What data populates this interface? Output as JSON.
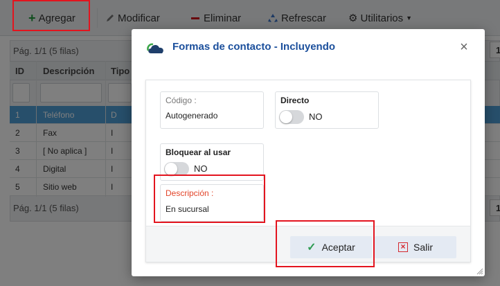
{
  "toolbar": {
    "add_label": "Agregar",
    "modify_label": "Modificar",
    "delete_label": "Eliminar",
    "refresh_label": "Refrescar",
    "utilities_label": "Utilitarios"
  },
  "grid": {
    "pager_top": "Pág. 1/1 (5 filas)",
    "pager_bottom": "Pág. 1/1 (5 filas)",
    "pager_page": "1",
    "columns": [
      "ID",
      "Descripción",
      "Tipo"
    ],
    "rows": [
      {
        "id": "1",
        "desc": "Teléfono",
        "tipo": "D"
      },
      {
        "id": "2",
        "desc": "Fax",
        "tipo": "I"
      },
      {
        "id": "3",
        "desc": "[ No aplica ]",
        "tipo": "I"
      },
      {
        "id": "4",
        "desc": "Digital",
        "tipo": "I"
      },
      {
        "id": "5",
        "desc": "Sitio web",
        "tipo": "I"
      }
    ]
  },
  "modal": {
    "title": "Formas de contacto - Incluyendo",
    "codigo_label": "Código :",
    "codigo_value": "Autogenerado",
    "directo_label": "Directo",
    "directo_value": "NO",
    "bloquear_label": "Bloquear al usar",
    "bloquear_value": "NO",
    "descripcion_label": "Descripción :",
    "descripcion_value": "En sucursal",
    "accept_label": "Aceptar",
    "exit_label": "Salir"
  },
  "colors": {
    "highlight": "#e3141e",
    "title_blue": "#1b4f9c",
    "selected_row": "#4e9ed6"
  }
}
